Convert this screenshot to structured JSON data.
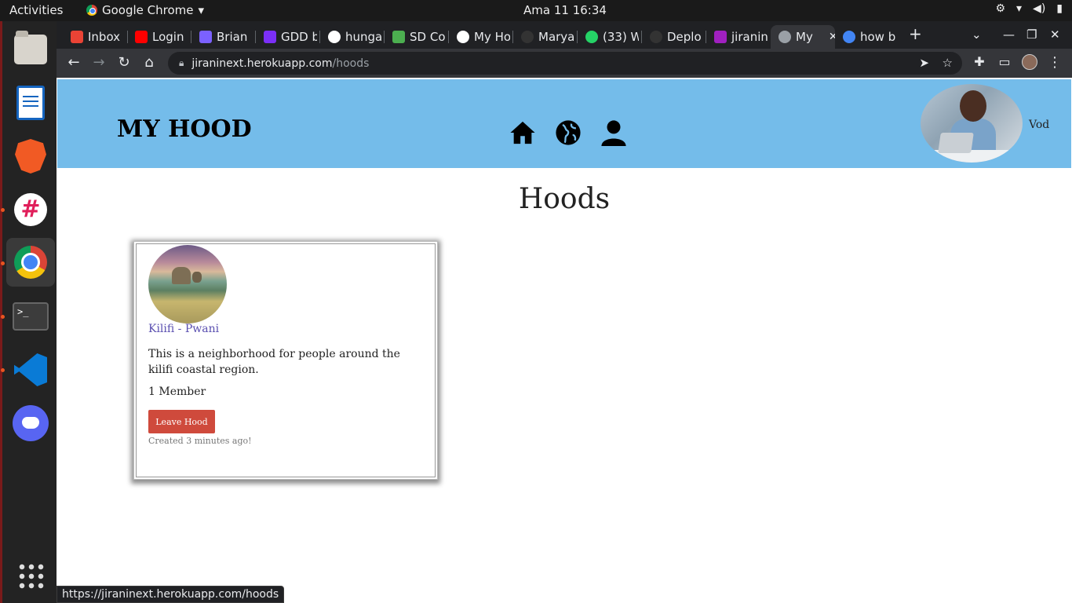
{
  "system": {
    "activities": "Activities",
    "app_name": "Google Chrome",
    "app_arrow": "▾",
    "clock": "Ama 11  16:34",
    "tray": [
      "⚙",
      "▾",
      "◀)",
      "▮"
    ]
  },
  "browser": {
    "tabs": [
      {
        "label": "Inbox",
        "color": "#ea4335"
      },
      {
        "label": "Login",
        "color": "#ff0000"
      },
      {
        "label": "Brian",
        "color": "#7b61ff"
      },
      {
        "label": "GDD b",
        "color": "#7b2ff7"
      },
      {
        "label": "hunga",
        "color": "#ffffff"
      },
      {
        "label": "SD Co",
        "color": "#4caf50"
      },
      {
        "label": "My Ho",
        "color": "#ffffff"
      },
      {
        "label": "Marya",
        "color": "#333333"
      },
      {
        "label": "(33) W",
        "color": "#25d366"
      },
      {
        "label": "Deplo",
        "color": "#333333"
      },
      {
        "label": "jiranin",
        "color": "#a020c0"
      },
      {
        "label": "My",
        "color": "#9aa0a6"
      },
      {
        "label": "how b",
        "color": "#4285f4"
      }
    ],
    "new_tab": "+",
    "url_host": "jiraninext.herokuapp.com",
    "url_path": "/hoods",
    "status_url": "https://jiraninext.herokuapp.com/hoods"
  },
  "page": {
    "brand": "MY HOOD",
    "username": "Vod",
    "heading": "Hoods",
    "hood": {
      "name": "Kilifi - Pwani",
      "description": "This is a neighborhood for people around the kilifi coastal region.",
      "members": "1 Member",
      "leave_label": "Leave Hood",
      "created": "Created 3 minutes ago!"
    }
  }
}
